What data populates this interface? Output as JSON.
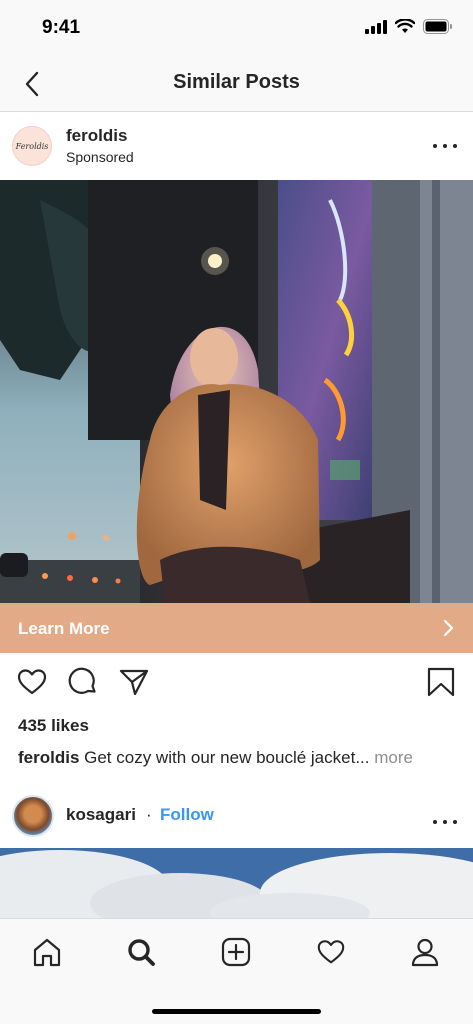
{
  "status_bar": {
    "time": "9:41"
  },
  "nav": {
    "title": "Similar Posts"
  },
  "post": {
    "brand_avatar_text": "Feroldis",
    "username": "feroldis",
    "sponsored_label": "Sponsored",
    "cta_label": "Learn More",
    "likes": "435 likes",
    "caption_user": "feroldis",
    "caption_text": " Get cozy with our new bouclé jacket...",
    "caption_more": " more"
  },
  "next_post": {
    "username": "kosagari",
    "separator": "·",
    "follow_label": "Follow"
  },
  "colors": {
    "cta": "#e3aa87",
    "follow": "#3897f0",
    "text": "#262626",
    "muted": "#8e8e8e"
  },
  "icons": {
    "status": [
      "signal-icon",
      "wifi-icon",
      "battery-icon"
    ],
    "actions": [
      "heart-icon",
      "comment-icon",
      "share-icon",
      "bookmark-icon"
    ],
    "tabs": [
      "home-icon",
      "search-icon",
      "add-icon",
      "activity-heart-icon",
      "profile-icon"
    ]
  }
}
